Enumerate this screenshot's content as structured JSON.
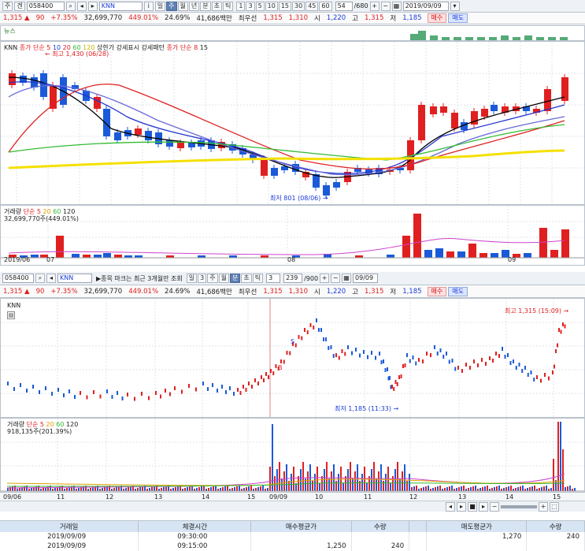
{
  "toolbar1": {
    "period": "주",
    "type": "겐",
    "code": "058400",
    "name": "KNN",
    "tabs": [
      "일",
      "주",
      "월",
      "년",
      "분",
      "초",
      "틱"
    ],
    "active_tab": "주",
    "nums": [
      "1",
      "3",
      "5",
      "10",
      "15",
      "30",
      "45",
      "60"
    ],
    "count": "54",
    "total": "/680",
    "date": "2019/09/09"
  },
  "quote": {
    "price": "1,315",
    "up_arrow": "▲",
    "change": "90",
    "pct": "+7.35%",
    "volume": "32,699,770",
    "vol_pct": "449.01%",
    "turnover": "24.69%",
    "amount": "41,686백만",
    "priority": "최우선",
    "ask1": "1,315",
    "bid1": "1,310",
    "open_l": "시",
    "open": "1,220",
    "high_l": "고",
    "high": "1,315",
    "low_l": "저",
    "low": "1,185",
    "buy": "매수",
    "sell": "매도"
  },
  "news_label": "뉴스",
  "chart1": {
    "name": "KNN",
    "legend_ma": "종가 단순 5",
    "legend_nums": [
      "10",
      "20",
      "60",
      "120"
    ],
    "legend_warn": "상한가 강세표시 강세패턴",
    "legend_ma2": "종가 단순 8",
    "legend_ma2_n": "15",
    "max_label": "최고 1,430 (06/28)",
    "min_label": "최저 801 (08/06)",
    "vol_title": "거래량",
    "vol_ma": "단순 5",
    "vol_nums": [
      "20",
      "60",
      "120"
    ],
    "vol_value": "32,699,770주(449.01%)",
    "xlabels": [
      "2019/06",
      "07",
      "08",
      "09"
    ]
  },
  "toolbar2": {
    "code": "058400",
    "name": "KNN",
    "notice": "▶종목 마크는 최근 3개월만 조회",
    "tabs": [
      "일",
      "3",
      "주",
      "월",
      "분",
      "초",
      "틱"
    ],
    "active_tab": "분",
    "count_sel": "3",
    "count": "239",
    "total": "/900",
    "date": "09/09"
  },
  "chart2": {
    "name": "KNN",
    "max_label": "최고 1,315 (15:09)",
    "min_label": "최저 1,185 (11:33)",
    "vol_title": "거래량",
    "vol_ma": "단순 5",
    "vol_nums": [
      "20",
      "60",
      "120"
    ],
    "vol_value": "918,135주(201.39%)",
    "xlabels": [
      "09/06",
      "11",
      "12",
      "13",
      "14",
      "15",
      "09/09",
      "10",
      "11",
      "12",
      "13",
      "14",
      "15"
    ]
  },
  "table": {
    "headers": [
      "거래일",
      "체결시간",
      "매수평균가",
      "수량",
      "",
      "매도평균가",
      "수량"
    ],
    "rows": [
      [
        "2019/09/09",
        "09:30:00",
        "",
        "",
        "",
        "1,270",
        "240"
      ],
      [
        "2019/09/09",
        "09:15:00",
        "1,250",
        "240",
        "",
        "",
        ""
      ]
    ]
  },
  "colors": {
    "up": "#e02020",
    "down": "#1a5ad8",
    "ma5": "#000000",
    "ma10": "#2233cc",
    "ma20": "#e02020",
    "ma60": "#33bb33",
    "ma120": "#f5e000"
  }
}
